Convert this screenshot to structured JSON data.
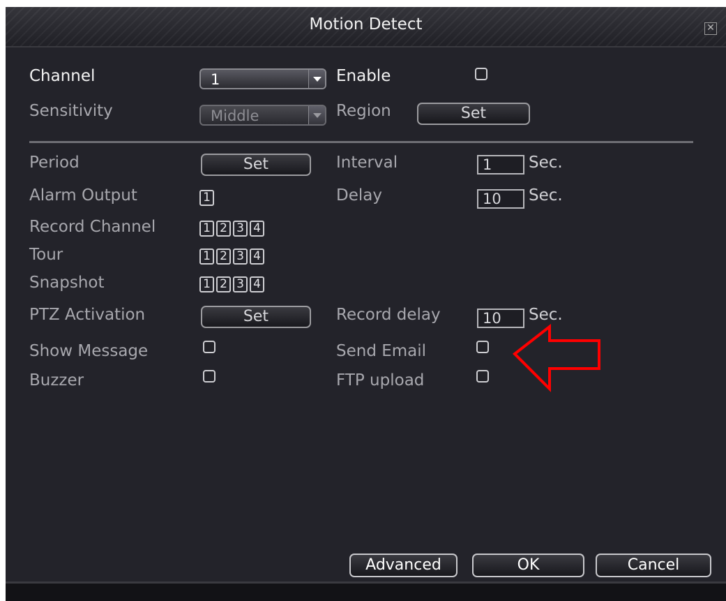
{
  "window": {
    "title": "Motion Detect",
    "close_glyph": "✕"
  },
  "channel": {
    "label": "Channel",
    "value": "1"
  },
  "enable": {
    "label": "Enable",
    "checked": false
  },
  "sensitivity": {
    "label": "Sensitivity",
    "value": "Middle"
  },
  "region": {
    "label": "Region",
    "button": "Set"
  },
  "period": {
    "label": "Period",
    "button": "Set"
  },
  "interval": {
    "label": "Interval",
    "value": "1",
    "unit": "Sec."
  },
  "alarm_output": {
    "label": "Alarm Output",
    "channels": [
      "1"
    ]
  },
  "delay": {
    "label": "Delay",
    "value": "10",
    "unit": "Sec."
  },
  "record_channel": {
    "label": "Record Channel",
    "channels": [
      "1",
      "2",
      "3",
      "4"
    ]
  },
  "tour": {
    "label": "Tour",
    "channels": [
      "1",
      "2",
      "3",
      "4"
    ]
  },
  "snapshot": {
    "label": "Snapshot",
    "channels": [
      "1",
      "2",
      "3",
      "4"
    ]
  },
  "ptz_activation": {
    "label": "PTZ Activation",
    "button": "Set"
  },
  "record_delay": {
    "label": "Record delay",
    "value": "10",
    "unit": "Sec."
  },
  "show_message": {
    "label": "Show Message",
    "checked": false
  },
  "send_email": {
    "label": "Send Email",
    "checked": false
  },
  "buzzer": {
    "label": "Buzzer",
    "checked": false
  },
  "ftp_upload": {
    "label": "FTP upload",
    "checked": false
  },
  "footer": {
    "advanced": "Advanced",
    "ok": "OK",
    "cancel": "Cancel"
  },
  "colors": {
    "background": "#23232a",
    "text": "#a8a8ae",
    "highlight": "#f4f4f4",
    "annotation": "#ff0000"
  },
  "icons": {
    "close": "close-icon",
    "dropdown": "chevron-down-icon",
    "annotation": "arrow-left-icon"
  }
}
